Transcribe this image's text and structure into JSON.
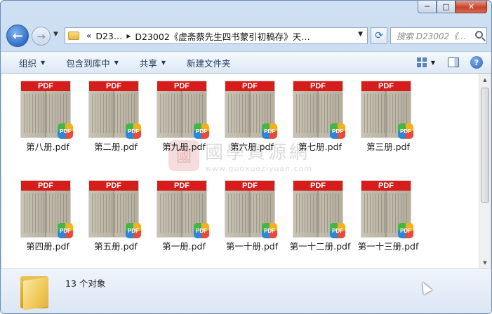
{
  "window": {
    "buttons": {
      "minimize": "─",
      "maximize": "□",
      "close": "✕"
    }
  },
  "nav": {
    "back_glyph": "←",
    "forward_glyph": "→",
    "history_dropdown": "▼",
    "breadcrumb_overflow": "«",
    "breadcrumbs": [
      "D23…",
      "D23002《虚斋蔡先生四书蒙引初稿存》天…"
    ],
    "breadcrumb_separator": "▸",
    "address_dropdown": "▼",
    "refresh_glyph": "⟳",
    "search_placeholder": "搜索 D23002《…"
  },
  "toolbar": {
    "items": [
      {
        "label": "组织",
        "has_arrow": true
      },
      {
        "label": "包含到库中",
        "has_arrow": true
      },
      {
        "label": "共享",
        "has_arrow": true
      },
      {
        "label": "新建文件夹",
        "has_arrow": false
      }
    ],
    "dropdown_arrow": "▼",
    "help_glyph": "?"
  },
  "files": [
    {
      "name": "第八册.pdf"
    },
    {
      "name": "第二册.pdf"
    },
    {
      "name": "第九册.pdf"
    },
    {
      "name": "第六册.pdf"
    },
    {
      "name": "第七册.pdf"
    },
    {
      "name": "第三册.pdf"
    },
    {
      "name": "第四册.pdf"
    },
    {
      "name": "第五册.pdf"
    },
    {
      "name": "第一册.pdf"
    },
    {
      "name": "第一十册.pdf"
    },
    {
      "name": "第一十二册.pdf"
    },
    {
      "name": "第一十三册.pdf"
    }
  ],
  "file_badge": "PDF",
  "watermark": {
    "logo_char": "國",
    "text": "國學資源網",
    "url": "www.guoxueziyuan.com"
  },
  "details": {
    "count": "13 个对象"
  },
  "colors": {
    "accent": "#2f6fc7",
    "pdf_red": "#d81c1c"
  }
}
